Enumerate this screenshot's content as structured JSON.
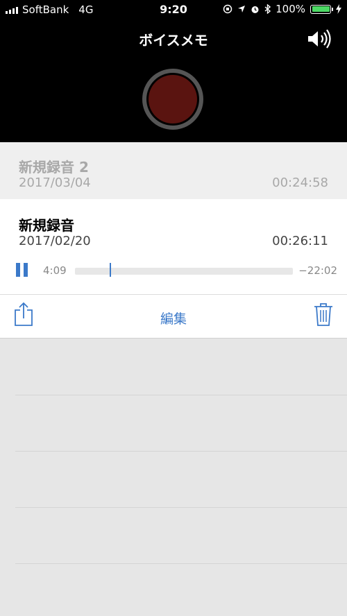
{
  "status": {
    "carrier": "SoftBank",
    "network": "4G",
    "time": "9:20",
    "battery": "100%"
  },
  "header": {
    "title": "ボイスメモ"
  },
  "recordings": [
    {
      "name": "新規録音 2",
      "date": "2017/03/04",
      "duration": "00:24:58"
    },
    {
      "name": "新規録音",
      "date": "2017/02/20",
      "duration": "00:26:11"
    }
  ],
  "player": {
    "elapsed": "4:09",
    "remaining": "−22:02",
    "progress": 0.158
  },
  "actions": {
    "edit_label": "編集"
  },
  "colors": {
    "accent": "#3b79c9",
    "record": "#5a1410",
    "battery": "#4cd964"
  }
}
